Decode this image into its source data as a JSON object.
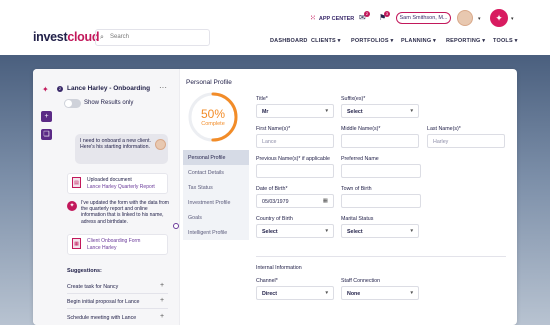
{
  "header": {
    "logo_main": "invest",
    "logo_accent": "cloud",
    "search_placeholder": "Search",
    "app_center": "APP CENTER",
    "mail_badge": "2",
    "notif_badge": "3",
    "user_name": "Sam Smithson, M..."
  },
  "nav": [
    "DASHBOARD",
    "CLIENTS ▾",
    "PORTFOLIOS ▾",
    "PLANNING ▾",
    "REPORTING ▾",
    "TOOLS ▾"
  ],
  "chat": {
    "title": "Lance Harley - Onboarding",
    "count": "2",
    "toggle_label": "Show Results only",
    "user_message": "I need to onboard a new client. Here's his starting information.",
    "upload_label": "Uploaded document",
    "upload_file": "Lance Harley Quarterly Report",
    "ai_message": "I've updated the form with the data from the quarterly report and online information that is linked to his name, adress and birthdate.",
    "form_title": "Client Onboarding Form",
    "form_sub": "Lance Harley",
    "suggestions_title": "Suggestions:",
    "suggestions": [
      "Create task for Nancy",
      "Begin initial proposal for Lance",
      "Schedule meeting with Lance"
    ]
  },
  "profile": {
    "title": "Personal Profile",
    "percent": "50%",
    "percent_value": 50,
    "complete": "Complete",
    "menu": [
      "Personal Profile",
      "Contact Details",
      "Tax Status",
      "Investment Profile",
      "Goals",
      "Intelligent Profile"
    ],
    "colors": {
      "ring": "#f28c28",
      "ring_track": "#eceef2",
      "accent": "#c2185b"
    }
  },
  "form": {
    "title_label": "Title*",
    "title_value": "Mr",
    "suffix_label": "Suffix(es)*",
    "suffix_value": "Select",
    "first_label": "First Name(s)*",
    "first_value": "Lance",
    "middle_label": "Middle Name(s)*",
    "middle_value": "",
    "last_label": "Last Name(s)*",
    "last_value": "Harley",
    "prev_label": "Previous Name(s)* if applicable",
    "prev_value": "",
    "pref_label": "Preferred Name",
    "pref_value": "",
    "dob_label": "Date of Birth*",
    "dob_value": "05/03/1979",
    "town_label": "Town of Birth",
    "town_value": "",
    "country_label": "Country of Birth",
    "country_value": "Select",
    "marital_label": "Marital Status",
    "marital_value": "Select",
    "internal_title": "Internal Information",
    "channel_label": "Channel*",
    "channel_value": "Direct",
    "staff_label": "Staff Connection",
    "staff_value": "None"
  }
}
